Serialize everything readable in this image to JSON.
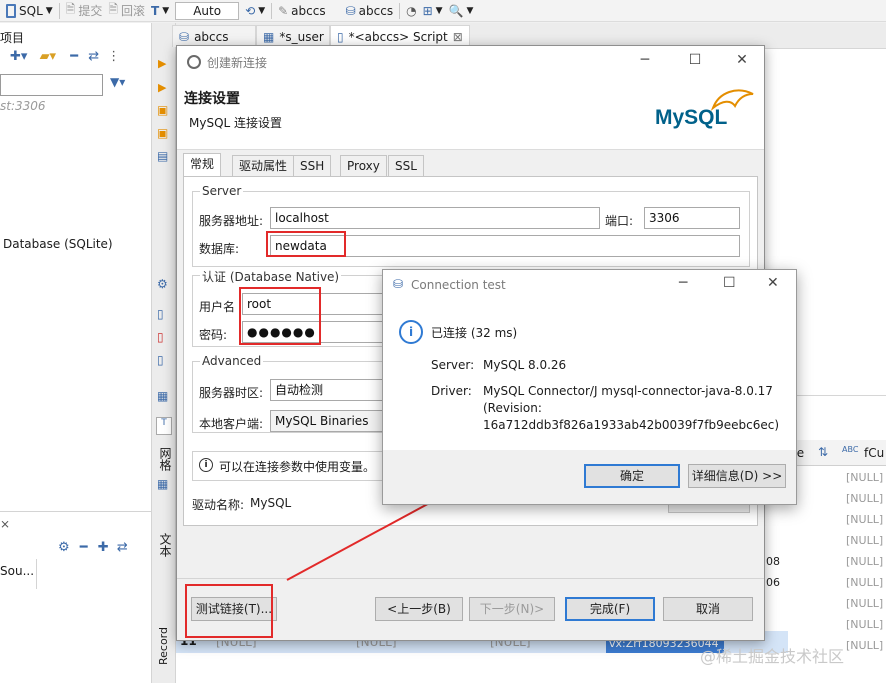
{
  "toolbar": {
    "sql_label": "SQL",
    "commit_label": "提交",
    "rollback_label": "回滚",
    "autocommit_value": "Auto",
    "datasource1": "abccs",
    "datasource2": "abccs"
  },
  "left_panel": {
    "title": "项目",
    "host_hint": "st:3306",
    "db_item": "Database (SQLite)",
    "bottom_item": "Sou..."
  },
  "editor": {
    "tabs": [
      {
        "label": "abccs"
      },
      {
        "label": "*s_user"
      },
      {
        "label": "*<abccs> Script"
      }
    ],
    "vertical_labels": {
      "grid": "网格",
      "text": "文本",
      "record": "Record"
    }
  },
  "dialog": {
    "window_title": "创建新连接",
    "header_title": "连接设置",
    "header_subtitle": "MySQL 连接设置",
    "logo_text": "MySQL",
    "tabs": [
      "常规",
      "驱动属性",
      "SSH",
      "Proxy",
      "SSL"
    ],
    "server": {
      "group_label": "Server",
      "host_label": "服务器地址:",
      "host_value": "localhost",
      "port_label": "端口:",
      "port_value": "3306",
      "db_label": "数据库:",
      "db_value": "newdata"
    },
    "auth": {
      "group_label": "认证 (Database Native)",
      "user_label": "用户名",
      "user_value": "root",
      "pass_label": "密码:",
      "pass_value": "●●●●●●"
    },
    "advanced": {
      "group_label": "Advanced",
      "tz_label": "服务器时区:",
      "tz_value": "自动检测",
      "client_label": "本地客户端:",
      "client_value": "MySQL Binaries"
    },
    "info_text": "可以在连接参数中使用变量。",
    "driver_label": "驱动名称:",
    "driver_value": "MySQL",
    "buttons": {
      "test": "测试链接(T)...",
      "back": "<上一步(B)",
      "next": "下一步(N)>",
      "finish": "完成(F)",
      "cancel": "取消"
    }
  },
  "connection_test": {
    "title": "Connection test",
    "status": "已连接 (32 ms)",
    "server_label": "Server:",
    "server_value": "MySQL 8.0.26",
    "driver_label": "Driver:",
    "driver_line1": "MySQL Connector/J mysql-connector-java-8.0.17",
    "driver_line2": "(Revision:",
    "driver_line3": "16a712ddb3f826a1933ab42b0039f7fb9eebc6ec)",
    "ok_button": "确定",
    "details_button": "详细信息(D) >>"
  },
  "grid": {
    "col_partial": "te",
    "col_header": "fCu",
    "null_text": "[NULL]",
    "partial_values": [
      "08",
      "06"
    ],
    "row_num": "11",
    "row_value": "vx:Zrf18093236044"
  },
  "watermark": "@稀土掘金技术社区",
  "colors": {
    "accent": "#2f7ad3",
    "highlight": "#e22a2a",
    "mysql_blue": "#00618a",
    "mysql_orange": "#e48e00"
  }
}
